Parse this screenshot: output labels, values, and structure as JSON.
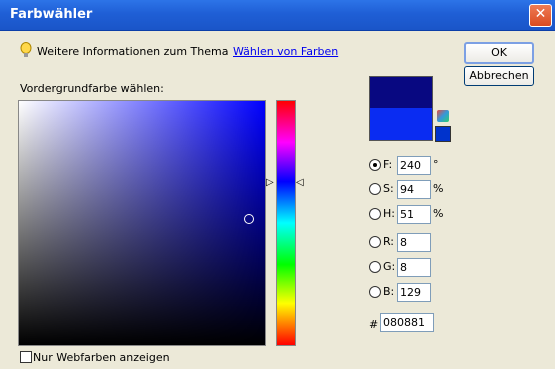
{
  "window": {
    "title": "Farbwähler",
    "close_label": "✕"
  },
  "info": {
    "text": "Weitere Informationen zum Thema",
    "link": "Wählen von Farben"
  },
  "buttons": {
    "ok": "OK",
    "cancel": "Abbrechen"
  },
  "picker": {
    "label": "Vordergrundfarbe wählen:"
  },
  "hsb": [
    {
      "label": "F:",
      "value": "240",
      "unit": "°"
    },
    {
      "label": "S:",
      "value": "94",
      "unit": "%"
    },
    {
      "label": "H:",
      "value": "51",
      "unit": "%"
    }
  ],
  "rgb": [
    {
      "label": "R:",
      "value": "8"
    },
    {
      "label": "G:",
      "value": "8"
    },
    {
      "label": "B:",
      "value": "129"
    }
  ],
  "hex": {
    "label": "#",
    "value": "080881"
  },
  "web_only": {
    "label": "Nur Webfarben anzeigen"
  },
  "colors": {
    "new": "#080881",
    "current": "#0a2cf2"
  }
}
